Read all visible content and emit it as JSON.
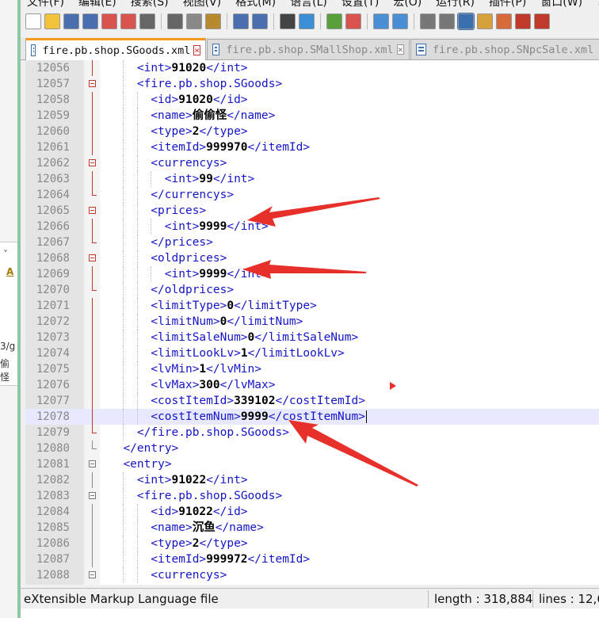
{
  "menu": [
    "文件(F)",
    "编辑(E)",
    "搜索(S)",
    "视图(V)",
    "格式(M)",
    "语言(L)",
    "设置(T)",
    "宏(O)",
    "运行(R)",
    "插件(P)",
    "窗口(W)",
    "?"
  ],
  "tabs": [
    {
      "label": "fire.pb.shop.SGoods.xml",
      "active": true
    },
    {
      "label": "fire.pb.shop.SMallShop.xml",
      "active": false
    },
    {
      "label": "fire.pb.shop.SNpcSale.xml",
      "active": false
    }
  ],
  "side_fragments": {
    "a": "A",
    "b": "3/g",
    "c": "偷怪"
  },
  "lines": [
    {
      "n": "12056",
      "indent": 4,
      "parts": [
        [
          "t",
          "<int>"
        ],
        [
          "v",
          "91020"
        ],
        [
          "t",
          "</int>"
        ]
      ],
      "fold": "vline"
    },
    {
      "n": "12057",
      "indent": 4,
      "parts": [
        [
          "t",
          "<fire.pb.shop.SGoods>"
        ]
      ],
      "fold": "box"
    },
    {
      "n": "12058",
      "indent": 6,
      "parts": [
        [
          "t",
          "<id>"
        ],
        [
          "v",
          "91020"
        ],
        [
          "t",
          "</id>"
        ]
      ],
      "fold": "vline"
    },
    {
      "n": "12059",
      "indent": 6,
      "parts": [
        [
          "t",
          "<name>"
        ],
        [
          "v",
          "偷偷怪"
        ],
        [
          "t",
          "</name>"
        ]
      ],
      "fold": "vline"
    },
    {
      "n": "12060",
      "indent": 6,
      "parts": [
        [
          "t",
          "<type>"
        ],
        [
          "v",
          "2"
        ],
        [
          "t",
          "</type>"
        ]
      ],
      "fold": "vline"
    },
    {
      "n": "12061",
      "indent": 6,
      "parts": [
        [
          "t",
          "<itemId>"
        ],
        [
          "v",
          "999970"
        ],
        [
          "t",
          "</itemId>"
        ]
      ],
      "fold": "vline"
    },
    {
      "n": "12062",
      "indent": 6,
      "parts": [
        [
          "t",
          "<currencys>"
        ]
      ],
      "fold": "box"
    },
    {
      "n": "12063",
      "indent": 8,
      "parts": [
        [
          "t",
          "<int>"
        ],
        [
          "v",
          "99"
        ],
        [
          "t",
          "</int>"
        ]
      ],
      "fold": "vline"
    },
    {
      "n": "12064",
      "indent": 6,
      "parts": [
        [
          "t",
          "</currencys>"
        ]
      ],
      "fold": "end"
    },
    {
      "n": "12065",
      "indent": 6,
      "parts": [
        [
          "t",
          "<prices>"
        ]
      ],
      "fold": "box"
    },
    {
      "n": "12066",
      "indent": 8,
      "parts": [
        [
          "t",
          "<int>"
        ],
        [
          "v",
          "9999"
        ],
        [
          "t",
          "</int>"
        ]
      ],
      "fold": "vline"
    },
    {
      "n": "12067",
      "indent": 6,
      "parts": [
        [
          "t",
          "</prices>"
        ]
      ],
      "fold": "end"
    },
    {
      "n": "12068",
      "indent": 6,
      "parts": [
        [
          "t",
          "<oldprices>"
        ]
      ],
      "fold": "box"
    },
    {
      "n": "12069",
      "indent": 8,
      "parts": [
        [
          "t",
          "<int>"
        ],
        [
          "v",
          "9999"
        ],
        [
          "t",
          "</int>"
        ]
      ],
      "fold": "vline"
    },
    {
      "n": "12070",
      "indent": 6,
      "parts": [
        [
          "t",
          "</oldprices>"
        ]
      ],
      "fold": "end"
    },
    {
      "n": "12071",
      "indent": 6,
      "parts": [
        [
          "t",
          "<limitType>"
        ],
        [
          "v",
          "0"
        ],
        [
          "t",
          "</limitType>"
        ]
      ],
      "fold": "vline"
    },
    {
      "n": "12072",
      "indent": 6,
      "parts": [
        [
          "t",
          "<limitNum>"
        ],
        [
          "v",
          "0"
        ],
        [
          "t",
          "</limitNum>"
        ]
      ],
      "fold": "vline"
    },
    {
      "n": "12073",
      "indent": 6,
      "parts": [
        [
          "t",
          "<limitSaleNum>"
        ],
        [
          "v",
          "0"
        ],
        [
          "t",
          "</limitSaleNum>"
        ]
      ],
      "fold": "vline"
    },
    {
      "n": "12074",
      "indent": 6,
      "parts": [
        [
          "t",
          "<limitLookLv>"
        ],
        [
          "v",
          "1"
        ],
        [
          "t",
          "</limitLookLv>"
        ]
      ],
      "fold": "vline"
    },
    {
      "n": "12075",
      "indent": 6,
      "parts": [
        [
          "t",
          "<lvMin>"
        ],
        [
          "v",
          "1"
        ],
        [
          "t",
          "</lvMin>"
        ]
      ],
      "fold": "vline"
    },
    {
      "n": "12076",
      "indent": 6,
      "parts": [
        [
          "t",
          "<lvMax>"
        ],
        [
          "v",
          "300"
        ],
        [
          "t",
          "</lvMax>"
        ]
      ],
      "fold": "vline"
    },
    {
      "n": "12077",
      "indent": 6,
      "parts": [
        [
          "t",
          "<costItemId>"
        ],
        [
          "v",
          "339102"
        ],
        [
          "t",
          "</costItemId>"
        ]
      ],
      "fold": "vline"
    },
    {
      "n": "12078",
      "indent": 6,
      "parts": [
        [
          "t",
          "<costItemNum>"
        ],
        [
          "v",
          "9999"
        ],
        [
          "t",
          "</costItemNum>"
        ]
      ],
      "fold": "vline",
      "current": true
    },
    {
      "n": "12079",
      "indent": 4,
      "parts": [
        [
          "t",
          "</fire.pb.shop.SGoods>"
        ]
      ],
      "fold": "end"
    },
    {
      "n": "12080",
      "indent": 2,
      "parts": [
        [
          "t",
          "</entry>"
        ]
      ],
      "fold": "greyend"
    },
    {
      "n": "12081",
      "indent": 2,
      "parts": [
        [
          "t",
          "<entry>"
        ]
      ],
      "fold": "greybox"
    },
    {
      "n": "12082",
      "indent": 4,
      "parts": [
        [
          "t",
          "<int>"
        ],
        [
          "v",
          "91022"
        ],
        [
          "t",
          "</int>"
        ]
      ],
      "fold": "greyvline"
    },
    {
      "n": "12083",
      "indent": 4,
      "parts": [
        [
          "t",
          "<fire.pb.shop.SGoods>"
        ]
      ],
      "fold": "greybox"
    },
    {
      "n": "12084",
      "indent": 6,
      "parts": [
        [
          "t",
          "<id>"
        ],
        [
          "v",
          "91022"
        ],
        [
          "t",
          "</id>"
        ]
      ],
      "fold": "greyvline"
    },
    {
      "n": "12085",
      "indent": 6,
      "parts": [
        [
          "t",
          "<name>"
        ],
        [
          "v",
          "沉鱼"
        ],
        [
          "t",
          "</name>"
        ]
      ],
      "fold": "greyvline"
    },
    {
      "n": "12086",
      "indent": 6,
      "parts": [
        [
          "t",
          "<type>"
        ],
        [
          "v",
          "2"
        ],
        [
          "t",
          "</type>"
        ]
      ],
      "fold": "greyvline"
    },
    {
      "n": "12087",
      "indent": 6,
      "parts": [
        [
          "t",
          "<itemId>"
        ],
        [
          "v",
          "999972"
        ],
        [
          "t",
          "</itemId>"
        ]
      ],
      "fold": "greyvline"
    },
    {
      "n": "12088",
      "indent": 6,
      "parts": [
        [
          "t",
          "<currencys>"
        ]
      ],
      "fold": "greybox"
    }
  ],
  "status": {
    "language": "eXtensible Markup Language file",
    "length": "length : 318,884",
    "lines": "lines : 12,6"
  },
  "colors": {
    "tag": "#1515c8",
    "value": "#000000",
    "fold": "#c0392b",
    "arrow": "#e8302a",
    "active_tab_accent": "#f29b1d"
  },
  "icons": [
    "new-file-icon",
    "open-file-icon",
    "save-icon",
    "save-all-icon",
    "close-icon",
    "close-all-icon",
    "print-icon",
    "cut-icon",
    "copy-icon",
    "paste-icon",
    "undo-icon",
    "redo-icon",
    "find-icon",
    "replace-icon",
    "zoom-in-icon",
    "zoom-out-icon",
    "sync-v-icon",
    "sync-h-icon",
    "wrap-icon",
    "show-all-icon",
    "indent-guide-icon",
    "doc-map-icon",
    "function-list-icon",
    "macro-record-icon",
    "macro-stop-icon"
  ]
}
